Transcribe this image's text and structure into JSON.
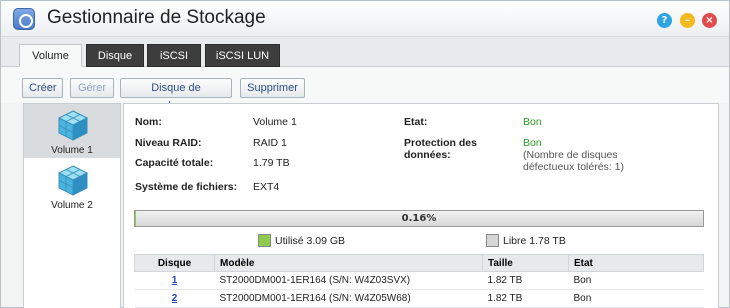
{
  "window": {
    "title": "Gestionnaire de Stockage"
  },
  "tabs": [
    "Volume",
    "Disque",
    "iSCSI",
    "iSCSI LUN"
  ],
  "toolbar": {
    "create": "Créer",
    "manage": "Gérer",
    "spare": "Disque de rechange",
    "delete": "Supprimer"
  },
  "volumes": [
    "Volume 1",
    "Volume 2"
  ],
  "details": {
    "name_label": "Nom:",
    "name": "Volume 1",
    "raid_label": "Niveau RAID:",
    "raid": "RAID 1",
    "capacity_label": "Capacité totale:",
    "capacity": "1.79 TB",
    "fs_label": "Système de fichiers:",
    "fs": "EXT4",
    "state_label": "Etat:",
    "state": "Bon",
    "protection_label_1": "Protection des",
    "protection_label_2": "données:",
    "protection": "Bon",
    "protection_note_1": "(Nombre de disques",
    "protection_note_2": "défectueux tolérés: 1)"
  },
  "usage": {
    "percent_text": "0.16%",
    "percent": 0.16,
    "used": "Utilisé 3.09 GB",
    "free": "Libre 1.78 TB",
    "used_color": "#8ecb4d",
    "free_color": "#d6d6d6"
  },
  "disks": {
    "headers": [
      "Disque",
      "Modèle",
      "Taille",
      "Etat"
    ],
    "rows": [
      {
        "id": "1",
        "model": "ST2000DM001-1ER164 (S/N: W4Z03SVX)",
        "size": "1.82 TB",
        "state": "Bon"
      },
      {
        "id": "2",
        "model": "ST2000DM001-1ER164 (S/N: W4Z05W68)",
        "size": "1.82 TB",
        "state": "Bon"
      }
    ]
  },
  "colors": {
    "accent": "#2a4f8a",
    "good": "#2e9b23",
    "tab_dark": "#3d3d3d"
  }
}
